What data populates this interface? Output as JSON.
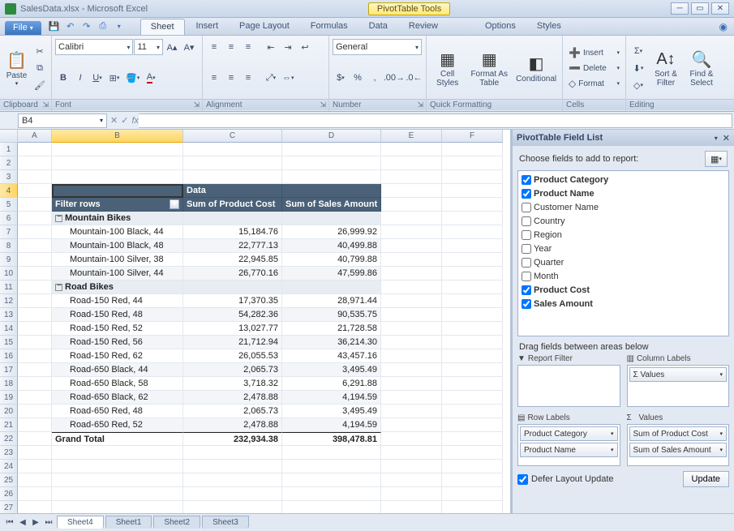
{
  "app": {
    "filename": "SalesData.xlsx",
    "appname": "Microsoft Excel",
    "context_tools": "PivotTable Tools"
  },
  "file_menu": "File",
  "ribbon_tabs": [
    "Sheet",
    "Insert",
    "Page Layout",
    "Formulas",
    "Data",
    "Review",
    "Options",
    "Styles"
  ],
  "active_tab_index": 0,
  "groups": {
    "clipboard": "Clipboard",
    "font": "Font",
    "alignment": "Alignment",
    "number": "Number",
    "quick": "Quick Formatting",
    "cells": "Cells",
    "editing": "Editing",
    "paste": "Paste",
    "font_name": "Calibri",
    "font_size": "11",
    "number_format": "General",
    "cell_styles": "Cell\nStyles",
    "format_as_table": "Format As\nTable",
    "conditional": "Conditional",
    "insert": "Insert",
    "delete": "Delete",
    "format": "Format",
    "sort_filter": "Sort &\nFilter",
    "find_select": "Find &\nSelect"
  },
  "name_box": "B4",
  "columns": [
    "A",
    "B",
    "C",
    "D",
    "E",
    "F"
  ],
  "selected_col_index": 1,
  "selected_row_index": 3,
  "pivot": {
    "data_label": "Data",
    "filter_rows": "Filter rows",
    "col1": "Sum of Product Cost",
    "col2": "Sum of Sales Amount",
    "groups": [
      {
        "name": "Mountain Bikes",
        "rows": [
          {
            "label": "Mountain-100 Black, 44",
            "c1": "15,184.76",
            "c2": "26,999.92"
          },
          {
            "label": "Mountain-100 Black, 48",
            "c1": "22,777.13",
            "c2": "40,499.88"
          },
          {
            "label": "Mountain-100 Silver, 38",
            "c1": "22,945.85",
            "c2": "40,799.88"
          },
          {
            "label": "Mountain-100 Silver, 44",
            "c1": "26,770.16",
            "c2": "47,599.86"
          }
        ]
      },
      {
        "name": "Road Bikes",
        "rows": [
          {
            "label": "Road-150 Red, 44",
            "c1": "17,370.35",
            "c2": "28,971.44"
          },
          {
            "label": "Road-150 Red, 48",
            "c1": "54,282.36",
            "c2": "90,535.75"
          },
          {
            "label": "Road-150 Red, 52",
            "c1": "13,027.77",
            "c2": "21,728.58"
          },
          {
            "label": "Road-150 Red, 56",
            "c1": "21,712.94",
            "c2": "36,214.30"
          },
          {
            "label": "Road-150 Red, 62",
            "c1": "26,055.53",
            "c2": "43,457.16"
          },
          {
            "label": "Road-650 Black, 44",
            "c1": "2,065.73",
            "c2": "3,495.49"
          },
          {
            "label": "Road-650 Black, 58",
            "c1": "3,718.32",
            "c2": "6,291.88"
          },
          {
            "label": "Road-650 Black, 62",
            "c1": "2,478.88",
            "c2": "4,194.59"
          },
          {
            "label": "Road-650 Red, 48",
            "c1": "2,065.73",
            "c2": "3,495.49"
          },
          {
            "label": "Road-650 Red, 52",
            "c1": "2,478.88",
            "c2": "4,194.59"
          }
        ]
      }
    ],
    "grand_total": {
      "label": "Grand Total",
      "c1": "232,934.38",
      "c2": "398,478.81"
    }
  },
  "task_pane": {
    "title": "PivotTable Field List",
    "choose": "Choose fields to add to report:",
    "fields": [
      {
        "name": "Product Category",
        "checked": true
      },
      {
        "name": "Product Name",
        "checked": true
      },
      {
        "name": "Customer Name",
        "checked": false
      },
      {
        "name": "Country",
        "checked": false
      },
      {
        "name": "Region",
        "checked": false
      },
      {
        "name": "Year",
        "checked": false
      },
      {
        "name": "Quarter",
        "checked": false
      },
      {
        "name": "Month",
        "checked": false
      },
      {
        "name": "Product Cost",
        "checked": true
      },
      {
        "name": "Sales Amount",
        "checked": true
      }
    ],
    "drag_label": "Drag fields between areas below",
    "report_filter": "Report Filter",
    "column_labels": "Column Labels",
    "row_labels": "Row Labels",
    "values": "Values",
    "sigma": "Σ",
    "col_items": [
      "Σ  Values"
    ],
    "row_items": [
      "Product Category",
      "Product Name"
    ],
    "val_items": [
      "Sum of Product Cost",
      "Sum of Sales Amount"
    ],
    "defer": "Defer Layout Update",
    "update": "Update"
  },
  "sheet_tabs": [
    "Sheet4",
    "Sheet1",
    "Sheet2",
    "Sheet3"
  ]
}
